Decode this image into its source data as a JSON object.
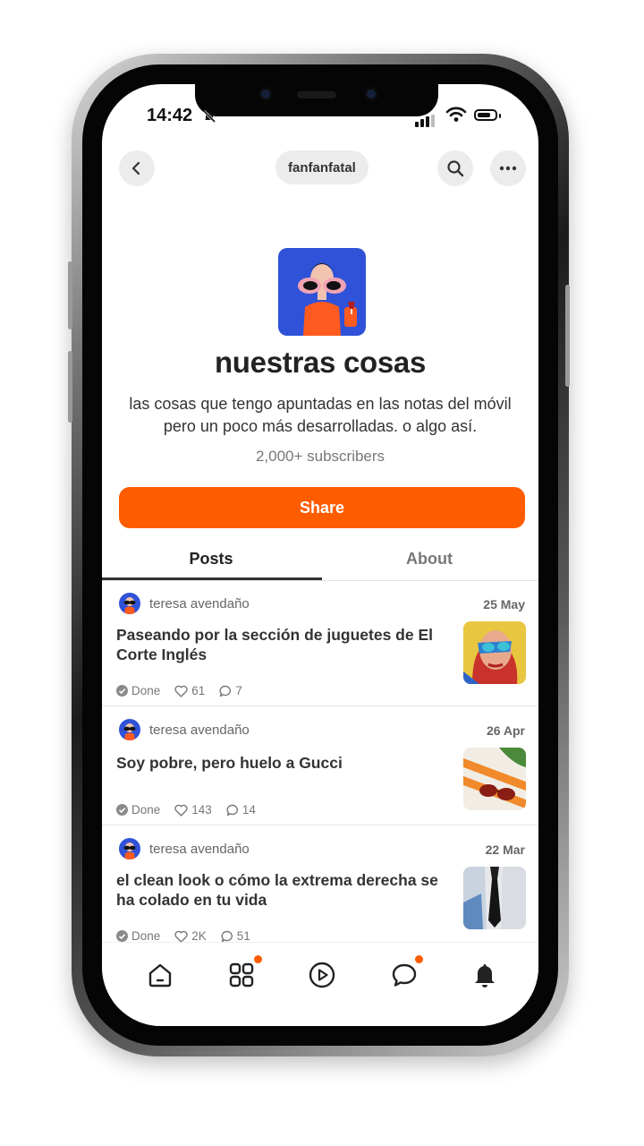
{
  "status_bar": {
    "time": "14:42"
  },
  "header": {
    "publication": "fanfanfatal"
  },
  "publication": {
    "title": "nuestras cosas",
    "description": "las cosas que tengo apuntadas en las notas del móvil pero un poco más desarrolladas. o algo así.",
    "subscribers": "2,000+ subscribers",
    "share_label": "Share"
  },
  "tabs": [
    {
      "label": "Posts",
      "active": true
    },
    {
      "label": "About",
      "active": false
    }
  ],
  "posts": [
    {
      "author": "teresa avendaño",
      "date": "25 May",
      "title": "Paseando por la sección de juguetes de El Corte Inglés",
      "status": "Done",
      "likes": "61",
      "comments": "7"
    },
    {
      "author": "teresa avendaño",
      "date": "26 Apr",
      "title": "Soy pobre, pero huelo a Gucci",
      "status": "Done",
      "likes": "143",
      "comments": "14"
    },
    {
      "author": "teresa avendaño",
      "date": "22 Mar",
      "title": "el clean look o cómo la extrema derecha se ha colado en tu vida",
      "status": "Done",
      "likes": "2K",
      "comments": "51"
    }
  ],
  "bottom_nav": [
    {
      "icon": "home-icon",
      "badge": false
    },
    {
      "icon": "grid-icon",
      "badge": true
    },
    {
      "icon": "play-icon",
      "badge": false
    },
    {
      "icon": "chat-icon",
      "badge": true
    },
    {
      "icon": "bell-icon",
      "badge": false
    }
  ],
  "colors": {
    "accent": "#ff5c00",
    "logo_bg": "#2f52d8"
  }
}
